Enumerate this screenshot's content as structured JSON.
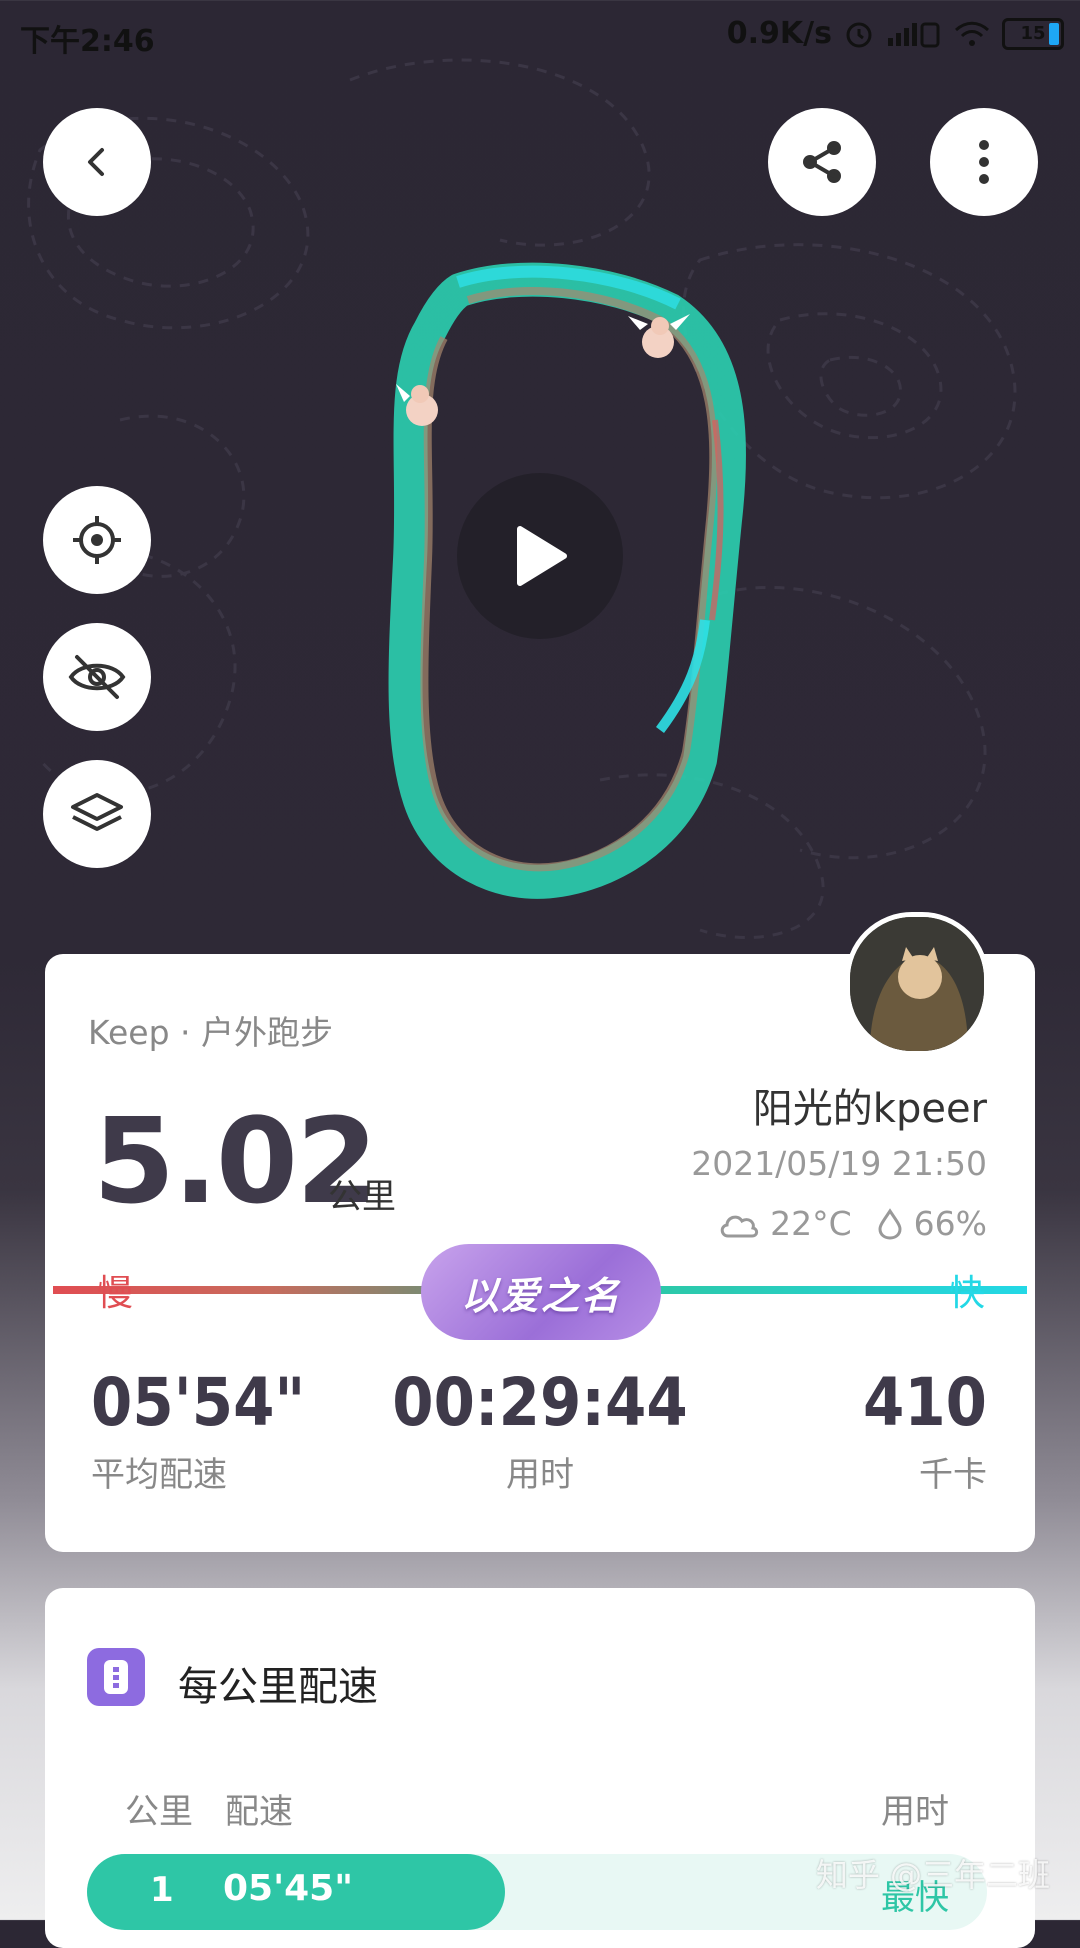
{
  "status_bar": {
    "time": "下午2:46",
    "network_speed": "0.9K/s",
    "battery": "15",
    "icons": [
      "alarm-icon",
      "signal-icon",
      "wifi-icon",
      "battery-icon"
    ]
  },
  "map": {
    "buttons": [
      "back-icon",
      "share-icon",
      "more-icon",
      "locate-icon",
      "hide-icon",
      "layers-icon",
      "play-icon"
    ]
  },
  "summary": {
    "source": "Keep · 户外跑步",
    "distance": "5.02",
    "distance_unit": "公里",
    "user_name": "阳光的kpeer",
    "datetime": "2021/05/19 21:50",
    "temperature": "22°C",
    "humidity": "66%",
    "slow_label": "慢",
    "fast_label": "快",
    "badge": "以爱之名",
    "avg_pace": "05'54\"",
    "avg_pace_label": "平均配速",
    "duration": "00:29:44",
    "duration_label": "用时",
    "calories": "410",
    "calories_label": "千卡"
  },
  "splits": {
    "title": "每公里配速",
    "col_km": "公里",
    "col_pace": "配速",
    "col_time": "用时",
    "rows": [
      {
        "km": "1",
        "pace": "05'45\"",
        "tag": "最快"
      }
    ]
  },
  "watermark": "知乎 @三年二班",
  "colors": {
    "slow": "#e04d52",
    "fast": "#23d8e6",
    "accent": "#2ec6a6",
    "badge": "#9b6fd8"
  }
}
